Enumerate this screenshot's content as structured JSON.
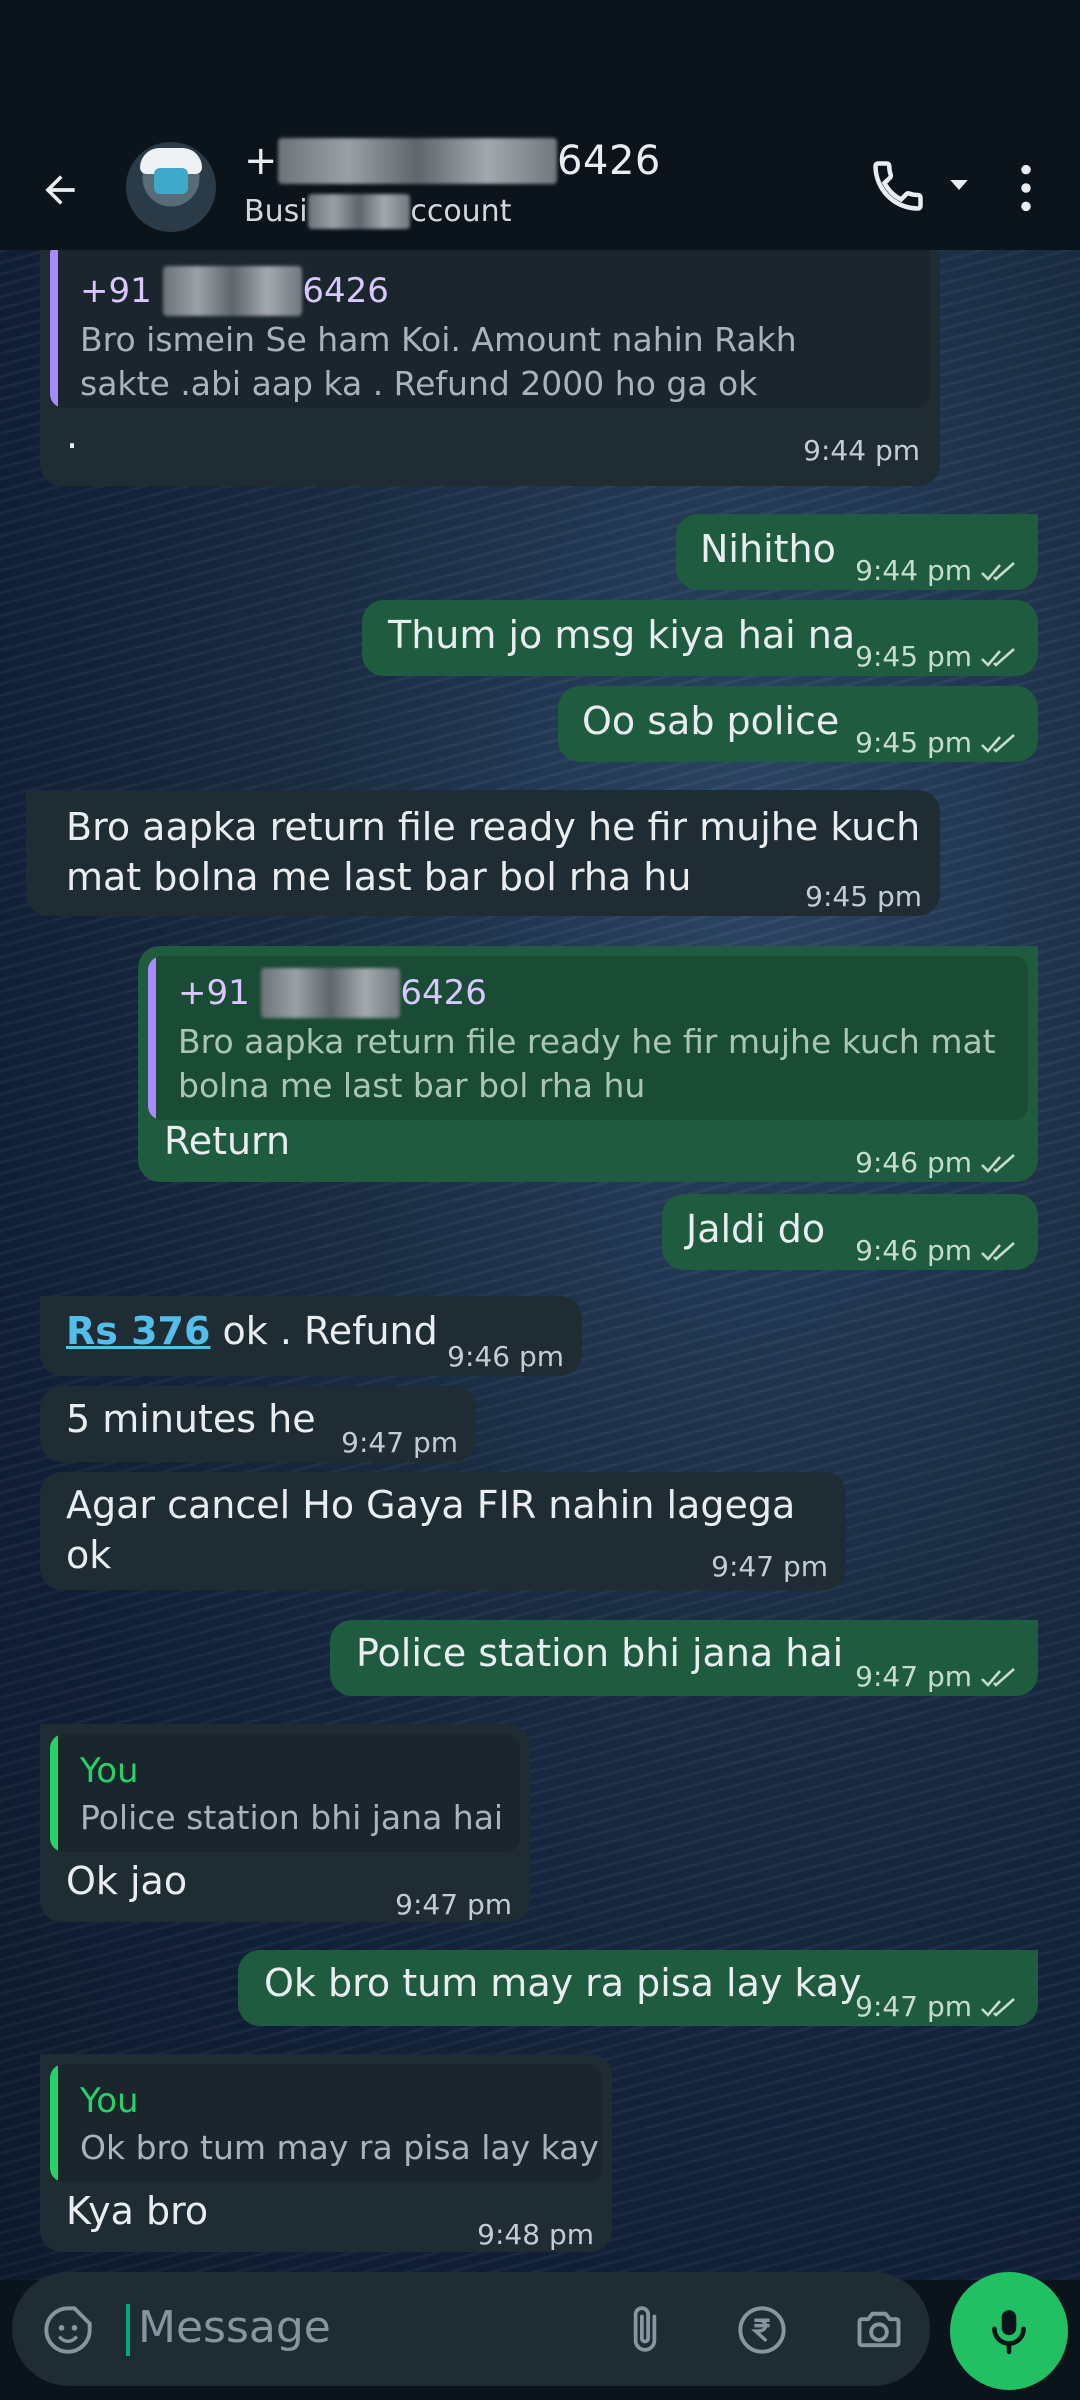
{
  "header": {
    "title_prefix": "+",
    "title_suffix": "6426",
    "subtitle_prefix": "Busi",
    "subtitle_suffix": "ccount"
  },
  "messages": [
    {
      "id": "m1",
      "dir": "in",
      "quote_name": "+91 ",
      "quote_name_suffix": "6426",
      "quote_lines": [
        "Bro ismein Se ham  Koi. Amount nahin Rakh",
        "sakte .abi aap ka . Refund 2000 ho ga ok"
      ],
      "text": ".",
      "time": "9:44 pm"
    },
    {
      "id": "m2",
      "dir": "out",
      "text": "Nihitho",
      "time": "9:44 pm"
    },
    {
      "id": "m3",
      "dir": "out",
      "text": "Thum jo msg kiya hai na",
      "time": "9:45 pm"
    },
    {
      "id": "m4",
      "dir": "out",
      "text": "Oo sab police",
      "time": "9:45 pm"
    },
    {
      "id": "m5",
      "dir": "in",
      "lines": [
        "Bro aapka return file ready he fir mujhe kuch",
        "mat bolna me last bar bol rha hu"
      ],
      "time": "9:45 pm"
    },
    {
      "id": "m6",
      "dir": "out",
      "quote_name": "+91 ",
      "quote_name_suffix": "6426",
      "quote_lines": [
        "Bro aapka return file ready he fir mujhe kuch mat",
        "bolna me last bar bol rha hu"
      ],
      "text": "Return",
      "time": "9:46 pm"
    },
    {
      "id": "m7",
      "dir": "out",
      "text": "Jaldi do",
      "time": "9:46 pm"
    },
    {
      "id": "m8",
      "dir": "in",
      "link": "Rs 376",
      "text": " ok . Refund",
      "time": "9:46 pm"
    },
    {
      "id": "m9",
      "dir": "in",
      "text": "5 minutes he",
      "time": "9:47 pm"
    },
    {
      "id": "m10",
      "dir": "in",
      "text": "Agar cancel Ho Gaya FIR nahin lagega ok",
      "time": "9:47 pm"
    },
    {
      "id": "m11",
      "dir": "out",
      "text": "Police station bhi jana hai",
      "time": "9:47 pm"
    },
    {
      "id": "m12",
      "dir": "in",
      "quote_name": "You",
      "quote_lines": [
        "Police station bhi jana hai"
      ],
      "text": "Ok jao",
      "time": "9:47 pm"
    },
    {
      "id": "m13",
      "dir": "out",
      "text": "Ok bro tum may ra pisa lay kay",
      "time": "9:47 pm"
    },
    {
      "id": "m14",
      "dir": "in",
      "quote_name": "You",
      "quote_lines": [
        "Ok bro tum may ra pisa lay kay"
      ],
      "text": "Kya bro",
      "time": "9:48 pm"
    }
  ],
  "input": {
    "placeholder": "Message"
  },
  "icons": {
    "back": "arrow-left-icon",
    "call": "phone-icon",
    "dropdown": "caret-down-icon",
    "menu": "more-vert-icon",
    "sticker": "sticker-icon",
    "attach": "paperclip-icon",
    "payment": "rupee-icon",
    "camera": "camera-icon",
    "mic": "mic-icon"
  },
  "colors": {
    "incoming_bubble": "#202c33",
    "outgoing_bubble": "#1f5c3f",
    "quote_bar_contact": "#a78bfa",
    "quote_bar_you": "#25d366",
    "link": "#53bdeb",
    "mic_button": "#21c063",
    "read_ticks": "#c6dccd"
  }
}
